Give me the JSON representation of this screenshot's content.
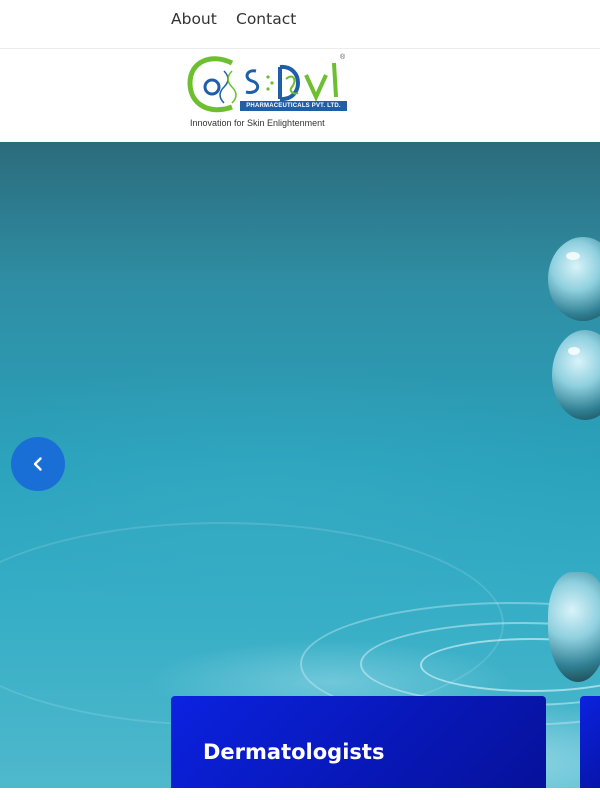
{
  "nav": {
    "about_label": "About",
    "contact_label": "Contact"
  },
  "logo": {
    "wordmark": "CosDvl",
    "company_band": "PHARMACEUTICALS PVT. LTD.",
    "registered_mark": "®",
    "tagline": "Innovation for Skin Enlightenment"
  },
  "hero": {
    "prev_icon": "chevron-left-icon",
    "card_title": "Dermatologists"
  },
  "colors": {
    "brand_blue": "#1e5fa8",
    "prev_button": "#1a6fd6",
    "card": "#0818b8",
    "logo_green": "#6cbf2e"
  }
}
